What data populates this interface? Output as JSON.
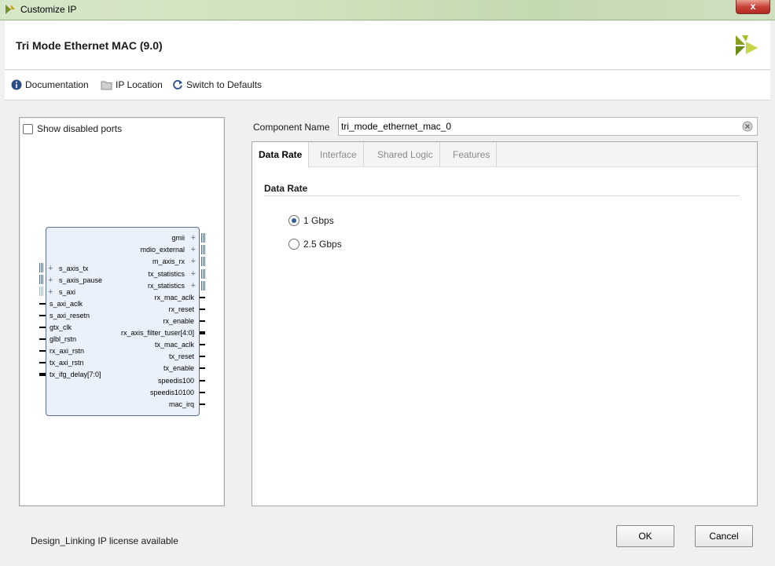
{
  "window": {
    "title": "Customize IP",
    "close_label": "x"
  },
  "header": {
    "title": "Tri Mode Ethernet MAC (9.0)"
  },
  "toolbar": {
    "documentation": "Documentation",
    "ip_location": "IP Location",
    "switch_defaults": "Switch to Defaults"
  },
  "left_panel": {
    "show_disabled_ports": "Show disabled ports",
    "left_ports": [
      "s_axis_tx",
      "s_axis_pause",
      "s_axi",
      "s_axi_aclk",
      "s_axi_resetn",
      "gtx_clk",
      "glbl_rstn",
      "rx_axi_rstn",
      "tx_axi_rstn",
      "tx_ifg_delay[7:0]"
    ],
    "right_ports": [
      "gmii",
      "mdio_external",
      "m_axis_rx",
      "tx_statistics",
      "rx_statistics",
      "rx_mac_aclk",
      "rx_reset",
      "rx_enable",
      "rx_axis_filter_tuser[4:0]",
      "tx_mac_aclk",
      "tx_reset",
      "tx_enable",
      "speedis100",
      "speedis10100",
      "mac_irq"
    ]
  },
  "component": {
    "label": "Component Name",
    "value": "tri_mode_ethernet_mac_0"
  },
  "tabs": [
    {
      "label": "Data Rate",
      "active": true
    },
    {
      "label": "Interface",
      "active": false
    },
    {
      "label": "Shared Logic",
      "active": false
    },
    {
      "label": "Features",
      "active": false
    }
  ],
  "data_rate": {
    "section_title": "Data Rate",
    "options": [
      {
        "label": "1 Gbps",
        "selected": true
      },
      {
        "label": "2.5 Gbps",
        "selected": false
      }
    ]
  },
  "footer": {
    "license": "Design_Linking IP license available",
    "ok": "OK",
    "cancel": "Cancel"
  },
  "colors": {
    "accent": "#2f5f9e",
    "block_fill": "#eaf1fa",
    "block_border": "#5a6f8e"
  }
}
